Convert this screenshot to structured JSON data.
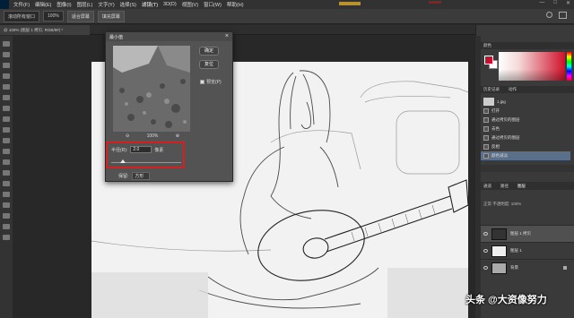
{
  "menubar": {
    "items": [
      "文件(F)",
      "编辑(E)",
      "图像(I)",
      "图层(L)",
      "文字(Y)",
      "选择(S)",
      "滤镜(T)",
      "3D(D)",
      "视图(V)",
      "窗口(W)",
      "帮助(H)"
    ]
  },
  "window_controls": {
    "minimize": "—",
    "maximize": "□",
    "close": "✕"
  },
  "optbar": {
    "tool_label": "滚动所有窗口",
    "zoom_value": "100%",
    "fit_screen": "适合屏幕",
    "fill_screen": "填充屏幕"
  },
  "doc_tab": {
    "label": "@ 100% (图层 1 拷贝, RGB/8#) *"
  },
  "dialog": {
    "title": "最小值",
    "close": "×",
    "ok": "确定",
    "reset": "复位",
    "preview_label": "预览(P)",
    "zoom_out": "⊖",
    "zoom_level": "100%",
    "zoom_in": "⊕",
    "radius_label": "半径(R):",
    "radius_value": "2.0",
    "radius_unit": "像素",
    "preserve_label": "保留:",
    "preserve_value": "方形"
  },
  "right_panel": {
    "color_tab": "颜色",
    "history_tabs": [
      "历史记录",
      "动作"
    ],
    "history_items": [
      {
        "label": "1.jpg",
        "snapshot": true
      },
      {
        "label": "打开"
      },
      {
        "label": "通过拷贝的图层"
      },
      {
        "label": "去色"
      },
      {
        "label": "通过拷贝的图层"
      },
      {
        "label": "反相"
      },
      {
        "label": "颜色减淡",
        "active": true
      }
    ],
    "layer_tabs": [
      "通道",
      "路径",
      "图层"
    ],
    "layer_controls": "正常  不透明度: 100%",
    "layers": [
      {
        "name": "图层 1 拷贝",
        "selected": true
      },
      {
        "name": "图层 1"
      },
      {
        "name": "背景"
      }
    ]
  },
  "watermark": "头条 @大资像努力",
  "colors": {
    "foreground": "#c8102e",
    "highlight": "#d42020"
  }
}
